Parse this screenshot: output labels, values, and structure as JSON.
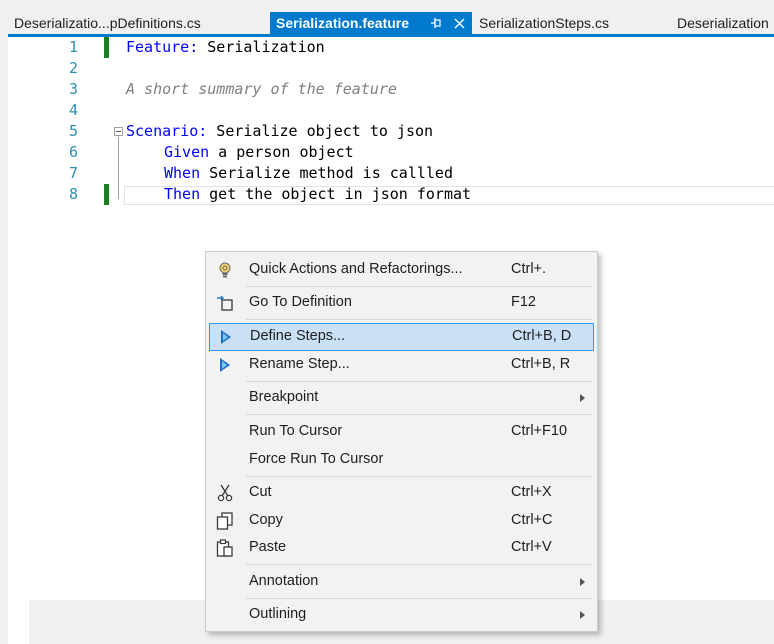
{
  "tabs": [
    {
      "label": "Deserializatio...pDefinitions.cs",
      "active": false
    },
    {
      "label": "Serialization.feature",
      "active": true
    },
    {
      "label": "SerializationSteps.cs",
      "active": false
    },
    {
      "label": "Deserialization",
      "active": false
    }
  ],
  "tab_icons": {
    "pin": "pin-icon",
    "close": "close-icon"
  },
  "editor": {
    "lines": [
      {
        "num": "1",
        "kw": "Feature:",
        "text": " Serialization"
      },
      {
        "num": "2",
        "kw": "",
        "text": ""
      },
      {
        "num": "3",
        "kw": "",
        "text": "A short summary of the feature"
      },
      {
        "num": "4",
        "kw": "",
        "text": ""
      },
      {
        "num": "5",
        "kw": "Scenario:",
        "text": " Serialize object to json"
      },
      {
        "num": "6",
        "kw": "Given",
        "text": " a person object"
      },
      {
        "num": "7",
        "kw": "When",
        "text": " Serialize method is callled"
      },
      {
        "num": "8",
        "kw": "Then",
        "text": " get the object in json format"
      }
    ]
  },
  "context_menu": {
    "items": [
      {
        "label": "Quick Actions and Refactorings...",
        "shortcut": "Ctrl+.",
        "icon": "lightbulb-icon"
      },
      {
        "label": "Go To Definition",
        "shortcut": "F12",
        "icon": "go-to-definition-icon"
      },
      {
        "label": "Define Steps...",
        "shortcut": "Ctrl+B, D",
        "icon": "specflow-icon"
      },
      {
        "label": "Rename Step...",
        "shortcut": "Ctrl+B, R",
        "icon": "specflow-icon"
      },
      {
        "label": "Breakpoint",
        "shortcut": "",
        "icon": ""
      },
      {
        "label": "Run To Cursor",
        "shortcut": "Ctrl+F10",
        "icon": ""
      },
      {
        "label": "Force Run To Cursor",
        "shortcut": "",
        "icon": ""
      },
      {
        "label": "Cut",
        "shortcut": "Ctrl+X",
        "icon": "scissors-icon"
      },
      {
        "label": "Copy",
        "shortcut": "Ctrl+C",
        "icon": "copy-icon"
      },
      {
        "label": "Paste",
        "shortcut": "Ctrl+V",
        "icon": "paste-icon"
      },
      {
        "label": "Annotation",
        "shortcut": "",
        "icon": ""
      },
      {
        "label": "Outlining",
        "shortcut": "",
        "icon": ""
      }
    ]
  },
  "colors": {
    "accent": "#007acc",
    "keyword": "#0000ff",
    "line_number": "#2b91af",
    "change_bar": "#1e7d1e",
    "menu_highlight": "#c9e0f7"
  }
}
